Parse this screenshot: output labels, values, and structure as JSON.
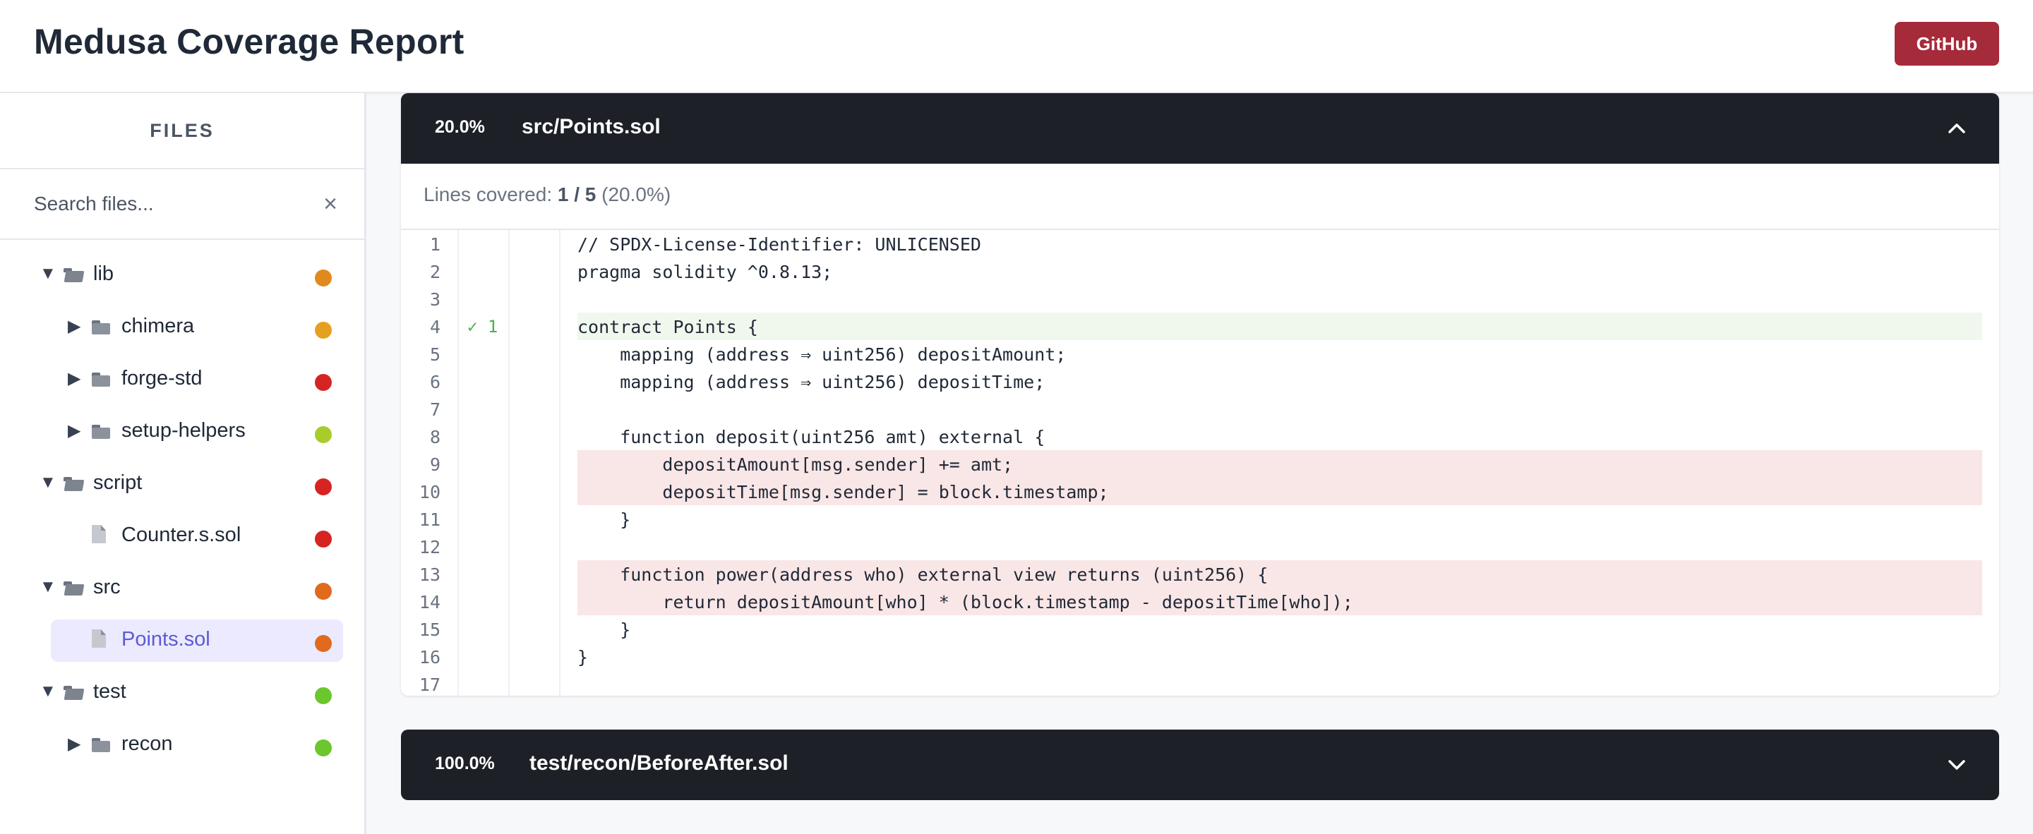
{
  "app": {
    "title": "Medusa Coverage Report",
    "github_label": "GitHub"
  },
  "sidebar": {
    "heading": "FILES",
    "search": {
      "placeholder": "Search files...",
      "value": "",
      "clear_icon": "×"
    },
    "tree": [
      {
        "label": "lib",
        "type": "folder",
        "expanded": true,
        "depth": 0,
        "arrow": "▼",
        "status_color": "#e08a1e"
      },
      {
        "label": "chimera",
        "type": "folder",
        "expanded": false,
        "depth": 1,
        "arrow": "▶",
        "status_color": "#e6a020"
      },
      {
        "label": "forge-std",
        "type": "folder",
        "expanded": false,
        "depth": 1,
        "arrow": "▶",
        "status_color": "#d62424"
      },
      {
        "label": "setup-helpers",
        "type": "folder",
        "expanded": false,
        "depth": 1,
        "arrow": "▶",
        "status_color": "#a8cc2c"
      },
      {
        "label": "script",
        "type": "folder",
        "expanded": true,
        "depth": 0,
        "arrow": "▼",
        "status_color": "#d62424"
      },
      {
        "label": "Counter.s.sol",
        "type": "file",
        "depth": 1,
        "arrow": "",
        "status_color": "#d62424"
      },
      {
        "label": "src",
        "type": "folder",
        "expanded": true,
        "depth": 0,
        "arrow": "▼",
        "status_color": "#e06a1e"
      },
      {
        "label": "Points.sol",
        "type": "file",
        "depth": 1,
        "arrow": "",
        "status_color": "#e06a1e",
        "selected": true
      },
      {
        "label": "test",
        "type": "folder",
        "expanded": true,
        "depth": 0,
        "arrow": "▼",
        "status_color": "#6cc62e"
      },
      {
        "label": "recon",
        "type": "folder",
        "expanded": false,
        "depth": 1,
        "arrow": "▶",
        "status_color": "#6cc62e"
      }
    ]
  },
  "main": {
    "files": [
      {
        "percent": "20.0%",
        "path": "src/Points.sol",
        "expanded": true,
        "summary": {
          "label": "Lines covered:",
          "covered": "1 / 5",
          "percent": "(20.0%)"
        },
        "lines": [
          {
            "n": "1",
            "hit": "",
            "status": "none",
            "code": "// SPDX-License-Identifier: UNLICENSED"
          },
          {
            "n": "2",
            "hit": "",
            "status": "none",
            "code": "pragma solidity ^0.8.13;"
          },
          {
            "n": "3",
            "hit": "",
            "status": "none",
            "code": ""
          },
          {
            "n": "4",
            "hit": "✓ 1",
            "status": "covered",
            "code": "contract Points {"
          },
          {
            "n": "5",
            "hit": "",
            "status": "none",
            "code": "    mapping (address ⇒ uint256) depositAmount;"
          },
          {
            "n": "6",
            "hit": "",
            "status": "none",
            "code": "    mapping (address ⇒ uint256) depositTime;"
          },
          {
            "n": "7",
            "hit": "",
            "status": "none",
            "code": ""
          },
          {
            "n": "8",
            "hit": "",
            "status": "none",
            "code": "    function deposit(uint256 amt) external {"
          },
          {
            "n": "9",
            "hit": "",
            "status": "uncovered",
            "code": "        depositAmount[msg.sender] += amt;"
          },
          {
            "n": "10",
            "hit": "",
            "status": "uncovered",
            "code": "        depositTime[msg.sender] = block.timestamp;"
          },
          {
            "n": "11",
            "hit": "",
            "status": "none",
            "code": "    }"
          },
          {
            "n": "12",
            "hit": "",
            "status": "none",
            "code": ""
          },
          {
            "n": "13",
            "hit": "",
            "status": "uncovered",
            "code": "    function power(address who) external view returns (uint256) {"
          },
          {
            "n": "14",
            "hit": "",
            "status": "uncovered",
            "code": "        return depositAmount[who] * (block.timestamp - depositTime[who]);"
          },
          {
            "n": "15",
            "hit": "",
            "status": "none",
            "code": "    }"
          },
          {
            "n": "16",
            "hit": "",
            "status": "none",
            "code": "}"
          },
          {
            "n": "17",
            "hit": "",
            "status": "none",
            "code": ""
          }
        ]
      },
      {
        "percent": "100.0%",
        "path": "test/recon/BeforeAfter.sol",
        "expanded": false
      }
    ]
  },
  "icons": {
    "collapse": "chevron-up-icon",
    "expand": "chevron-down-icon",
    "folder": "folder-icon",
    "file": "file-icon",
    "clear": "close-icon"
  }
}
